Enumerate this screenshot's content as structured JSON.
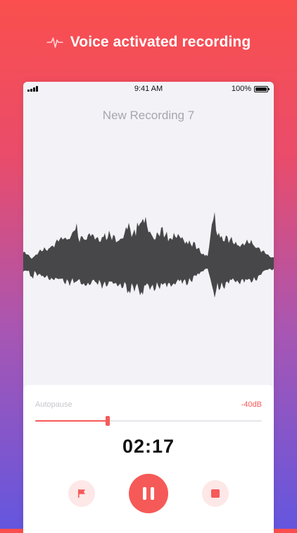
{
  "hero": {
    "title": "Voice activated recording",
    "icon": "pulse-icon"
  },
  "status_bar": {
    "time": "9:41 AM",
    "battery": "100%"
  },
  "recording": {
    "name": "New Recording 7",
    "timer": "02:17"
  },
  "autopause": {
    "label": "Autopause",
    "threshold": "-40dB",
    "slider_fraction": 0.32
  },
  "controls": {
    "flag_icon": "flag-icon",
    "pause_icon": "pause-icon",
    "stop_icon": "stop-icon"
  },
  "colors": {
    "accent": "#f55a58",
    "accent_light": "#fde7e7",
    "waveform": "#474749"
  }
}
